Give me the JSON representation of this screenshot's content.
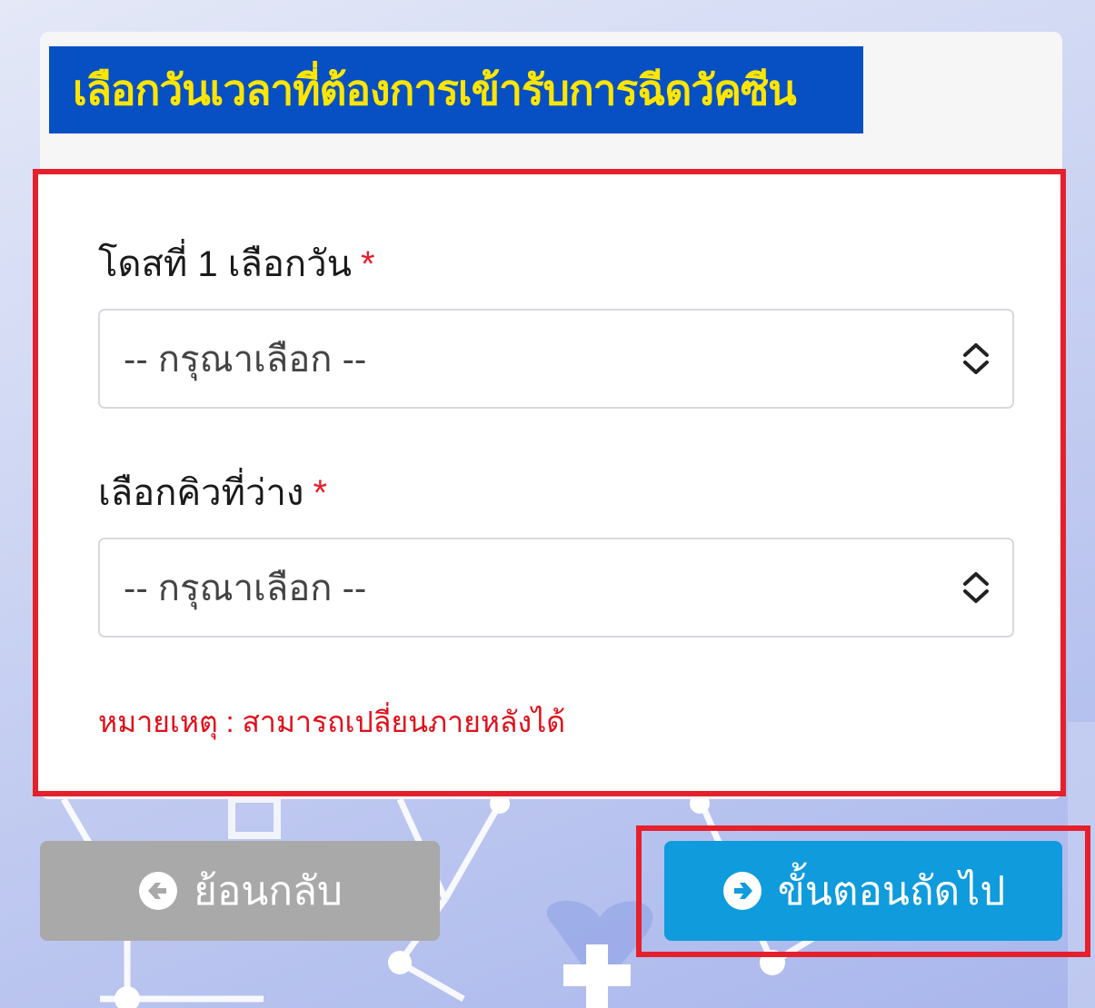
{
  "header": {
    "title": "เลือกวันเวลาที่ต้องการเข้ารับการฉีดวัคซีน"
  },
  "form": {
    "dose_date": {
      "label": "โดสที่ 1 เลือกวัน",
      "required_mark": "*",
      "placeholder": "-- กรุณาเลือก --"
    },
    "time_slot": {
      "label": "เลือกคิวที่ว่าง",
      "required_mark": "*",
      "placeholder": "-- กรุณาเลือก --"
    },
    "note": "หมายเหตุ : สามารถเปลี่ยนภายหลังได้"
  },
  "buttons": {
    "back": {
      "label": "ย้อนกลับ",
      "icon": "arrow-left-circle-icon"
    },
    "next": {
      "label": "ขั้นตอนถัดไป",
      "icon": "arrow-right-circle-icon"
    }
  },
  "colors": {
    "title_bg": "#0650c3",
    "title_text": "#ffe600",
    "highlight": "#e5202c",
    "next_button": "#0f9bdc",
    "back_button": "#a9a9a9",
    "note_text": "#e0101a"
  }
}
